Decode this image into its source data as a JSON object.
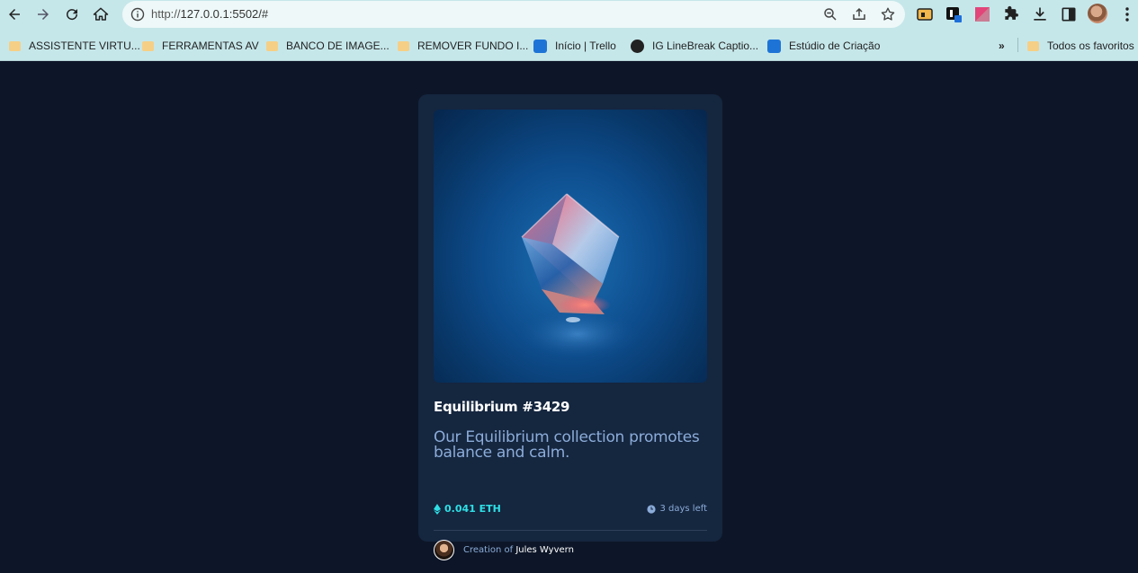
{
  "browser": {
    "url_protocol": "http://",
    "url_rest": "127.0.0.1:5502/#",
    "bookmarks": [
      {
        "label": "ASSISTENTE VIRTU...",
        "type": "folder"
      },
      {
        "label": "FERRAMENTAS AV",
        "type": "folder"
      },
      {
        "label": "BANCO DE IMAGE...",
        "type": "folder"
      },
      {
        "label": "REMOVER FUNDO I...",
        "type": "folder"
      },
      {
        "label": "Início | Trello",
        "type": "trello"
      },
      {
        "label": "IG LineBreak Captio...",
        "type": "globe"
      },
      {
        "label": "Estúdio de Criação",
        "type": "studio"
      }
    ],
    "more_bookmarks": "»",
    "all_favorites": "Todos os favoritos"
  },
  "card": {
    "title": "Equilibrium #3429",
    "description": "Our Equilibrium collection promotes balance and calm.",
    "price": "0.041 ETH",
    "time_left": "3 days left",
    "creator_prefix": "Creation of",
    "creator_name": "Jules Wyvern"
  },
  "colors": {
    "page_bg": "#0d1628",
    "card_bg": "#15263f",
    "accent_cyan": "#2ee0e6",
    "soft_blue": "#8bacd9",
    "chrome_bg": "#c6e7ea"
  },
  "icons": [
    "back-arrow-icon",
    "forward-arrow-icon",
    "reload-icon",
    "home-icon",
    "info-icon",
    "zoom-icon",
    "share-icon",
    "star-icon",
    "extensions-icon",
    "download-icon",
    "sidepanel-icon",
    "menu-icon",
    "ethereum-icon",
    "clock-icon"
  ]
}
